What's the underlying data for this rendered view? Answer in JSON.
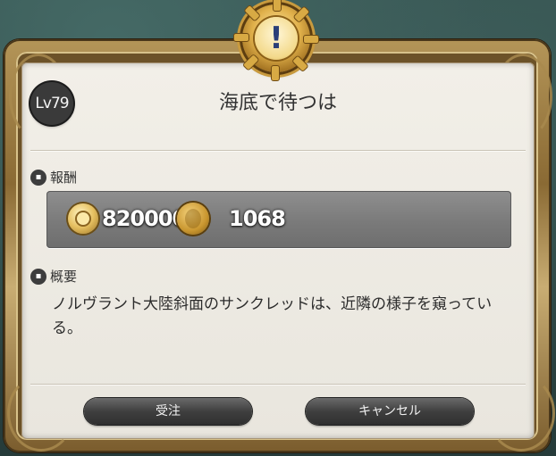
{
  "quest": {
    "level": "Lv79",
    "title": "海底で待つは"
  },
  "rewards": {
    "label": "報酬",
    "gil": "820000",
    "currency": "1068",
    "icons": [
      "gil-icon",
      "coin-icon"
    ]
  },
  "overview": {
    "label": "概要",
    "text": "ノルヴラント大陸斜面のサンクレッドは、近隣の様子を窺っている。"
  },
  "buttons": {
    "accept": "受注",
    "cancel": "キャンセル"
  },
  "colors": {
    "frame": "#b49558",
    "panel": "#f2efe8",
    "emblem_gold": "#e0b04a"
  }
}
